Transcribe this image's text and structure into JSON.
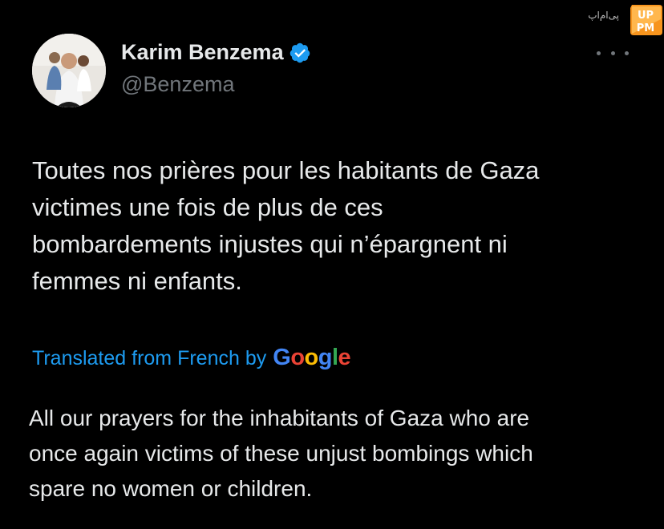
{
  "watermark": {
    "text": "پی‌ام‌اپ",
    "logo_text": "UP PM"
  },
  "author": {
    "display_name": "Karim Benzema",
    "handle": "@Benzema",
    "verified": true
  },
  "tweet": {
    "text_lines": [
      "Toutes nos prières pour les habitants de Gaza",
      "victimes une fois de plus de ces",
      "bombardements injustes qui n’épargnent ni",
      "femmes ni enfants."
    ]
  },
  "translation": {
    "label": "Translated from French by",
    "provider": "Google",
    "text_lines": [
      "All our prayers for the inhabitants of Gaza who are",
      "once again victims of these unjust bombings which",
      "spare no women or children."
    ]
  },
  "colors": {
    "background": "#000000",
    "text": "#e7e9ea",
    "secondary": "#71767b",
    "link": "#1d9bf0",
    "verified": "#1d9bf0"
  },
  "icons": [
    "verified-badge-icon",
    "more-options-icon"
  ]
}
